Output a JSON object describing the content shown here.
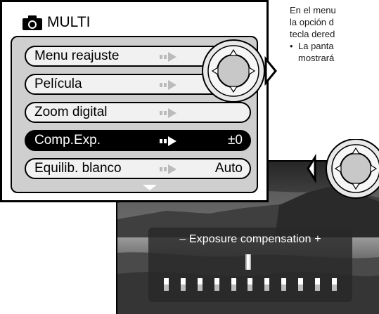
{
  "instructions": {
    "line1": "En el menu",
    "line2": "la opción d",
    "line3": "tecla dered",
    "bullet": "•",
    "line4": "La panta",
    "line5": "mostrará"
  },
  "menu": {
    "title": "MULTI",
    "items": [
      {
        "label": "Menu reajuste",
        "value": ""
      },
      {
        "label": "Película",
        "value": ""
      },
      {
        "label": "Zoom digital",
        "value": ""
      },
      {
        "label": "Comp.Exp.",
        "value": "±0"
      },
      {
        "label": "Equilib. blanco",
        "value": "Auto"
      }
    ],
    "selected_index": 3
  },
  "exposure": {
    "title": "– Exposure compensation +",
    "current_step": 5,
    "steps": 11
  },
  "icons": {
    "camera": "camera-icon",
    "controller": "four-way-controller-icon"
  }
}
